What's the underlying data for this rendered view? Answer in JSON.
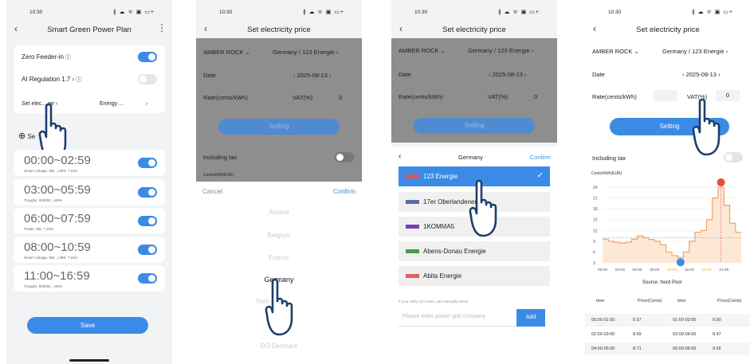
{
  "status": {
    "time": "10:30",
    "icons": "∦ ☁ ᯤ ▣ ▭+"
  },
  "p1": {
    "title": "Smart Green Power Plan",
    "zero_feeder": "Zero Feeder-in",
    "ai_reg": "AI Regulation 1.7",
    "set_elec": "Set elec... ee",
    "energy": "Energy ...",
    "add_label": "Se",
    "slots": [
      {
        "time": "00:00~02:59",
        "sub": "Smart Linkage, 0W, ⇣99% ⇡10%"
      },
      {
        "time": "03:00~05:59",
        "sub": "Troughs, 5000W, ⇣65%"
      },
      {
        "time": "06:00~07:59",
        "sub": "Peaks, 0W, ⇡10%"
      },
      {
        "time": "08:00~10:59",
        "sub": "Smart Linkage, 0W, ⇣99% ⇡10%"
      },
      {
        "time": "11:00~16:59",
        "sub": "Troughs, 5000W, ⇣80%"
      }
    ],
    "save": "Save"
  },
  "p2": {
    "title": "Set electricity price",
    "provider": "AMBER ROCK",
    "country": "Germany / 123 Energie",
    "date_label": "Date",
    "date": "2025-08-13",
    "rate_label": "Rate(cents/kWh)",
    "vat": "VAT(%)",
    "vat_val": "0",
    "setting": "Setting",
    "including_tax": "Including tax",
    "unit": "Cents/kWh(EUR)",
    "cancel": "Cancel",
    "confirm": "Confirm",
    "countries": [
      "Austria",
      "Belgium",
      "France",
      "Germany",
      "Neth",
      "land",
      "DO Denmark"
    ]
  },
  "p3": {
    "title": "Set electricity price",
    "provider": "AMBER ROCK",
    "country": "Germany / 123 Energie",
    "date_label": "Date",
    "date": "2025-08-13",
    "rate_label": "Rate(cents/kWh)",
    "vat": "VAT(%)",
    "vat_val": "0",
    "setting": "Setting",
    "sheet_title": "Germany",
    "confirm": "Confirm",
    "companies": [
      "123 Energie",
      "17er Oberlandenergie",
      "1KOMMA5",
      "Abens-Donau Energie",
      "Abita Energie"
    ],
    "hint": "If your utility isn't listed, add manually below:",
    "placeholder": "Please enter power grid company",
    "add": "Add"
  },
  "p4": {
    "title": "Set electricity price",
    "provider": "AMBER ROCK",
    "country": "Germany / 123 Energie",
    "date_label": "Date",
    "date": "2025-08-13",
    "rate_label": "Rate(cents/kWh)",
    "vat": "VAT(%)",
    "vat_val": "0",
    "setting": "Setting",
    "including_tax": "Including tax",
    "source": "Source: Nord Pool",
    "table_headers": [
      "time",
      "Price(Cents)",
      "time",
      "Price(Cents)"
    ],
    "table_rows": [
      [
        "00:00-01:00",
        "9.57",
        "01:00-02:00",
        "9.00"
      ],
      [
        "02:00-03:00",
        "8.69",
        "03:00-04:00",
        "8.47"
      ],
      [
        "04:00-05:00",
        "8.71",
        "05:00-06:00",
        "9.55"
      ]
    ]
  },
  "chart_data": {
    "type": "line",
    "ylabel": "Cents/kWh(EUR)",
    "y_ticks": [
      3,
      6,
      9,
      12,
      15,
      18,
      21,
      24
    ],
    "x_ticks": [
      "00:00",
      "03:00",
      "06:00",
      "09:00",
      "12:00",
      "15:00",
      "18:00",
      "21:00"
    ],
    "x": [
      "00:00",
      "01:00",
      "02:00",
      "03:00",
      "04:00",
      "05:00",
      "06:00",
      "07:00",
      "08:00",
      "09:00",
      "10:00",
      "11:00",
      "12:00",
      "13:00",
      "14:00",
      "15:00",
      "16:00",
      "17:00",
      "18:00",
      "19:00",
      "20:00",
      "21:00",
      "22:00",
      "23:00"
    ],
    "values": [
      9.57,
      9.0,
      8.69,
      8.47,
      8.71,
      9.55,
      10.5,
      10.0,
      9.5,
      9.0,
      8.0,
      6.0,
      5.0,
      4.5,
      6.0,
      9.0,
      11.5,
      12.0,
      15.0,
      21.0,
      24.0,
      19.0,
      14.0,
      11.5
    ],
    "ylim": [
      3,
      26
    ],
    "average_line": 10,
    "max": 24.0,
    "min": 4.5,
    "colors": {
      "line": "#f5a25d",
      "fill": "#fde8d6",
      "max_marker": "#e84b3c",
      "min_marker": "#3b8be6",
      "average": "#7fc6d8"
    }
  }
}
